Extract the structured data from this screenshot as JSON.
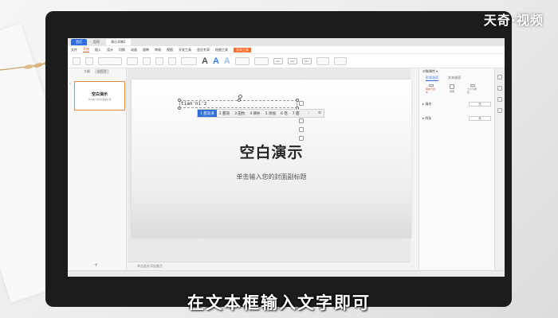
{
  "watermark": "天奇·视频",
  "caption": "在文本框输入文字即可",
  "titlebar": {
    "home_tab": "首页",
    "tab2": "稻壳",
    "active_doc": "演示文稿1"
  },
  "menubar": {
    "items": [
      "文件",
      "开始",
      "插入",
      "设计",
      "切换",
      "动画",
      "放映",
      "审阅",
      "视图",
      "开发工具",
      "会员专享",
      "绘图工具",
      "文本工具"
    ],
    "selected_index": 1,
    "highlight_index": 12
  },
  "left_panel": {
    "tabs": [
      "大纲",
      "幻灯片"
    ],
    "active_tab": 1,
    "thumb_number": "1",
    "thumb_title": "空白演示",
    "thumb_subtitle": "单击输入您的封面副标题",
    "add_icon": "+"
  },
  "slide": {
    "title": "空白演示",
    "subtitle": "单击输入您的封面副标题",
    "textbox_text": "tian'ni'z"
  },
  "ime": {
    "candidates": [
      "1 甜泥泽",
      "2 甜泥",
      "3 田你",
      "4 填补",
      "5 添加",
      "6 恬",
      "7 甜"
    ],
    "arrow": "›",
    "settings": "⚙"
  },
  "notes": {
    "placeholder": "单击此处添加备注"
  },
  "right_panel": {
    "header": "对象属性 ▾",
    "tabs": [
      "形状选项",
      "文本选项"
    ],
    "active_tab": 0,
    "icons": [
      "填充与线条",
      "效果",
      "大小与属性"
    ],
    "rows": [
      {
        "label": "▸ 填充",
        "value": "无"
      },
      {
        "label": "▸ 线条",
        "value": "无"
      }
    ]
  },
  "ribbon": {
    "style_labels": [
      "Abc",
      "Abc",
      "Abc"
    ]
  }
}
